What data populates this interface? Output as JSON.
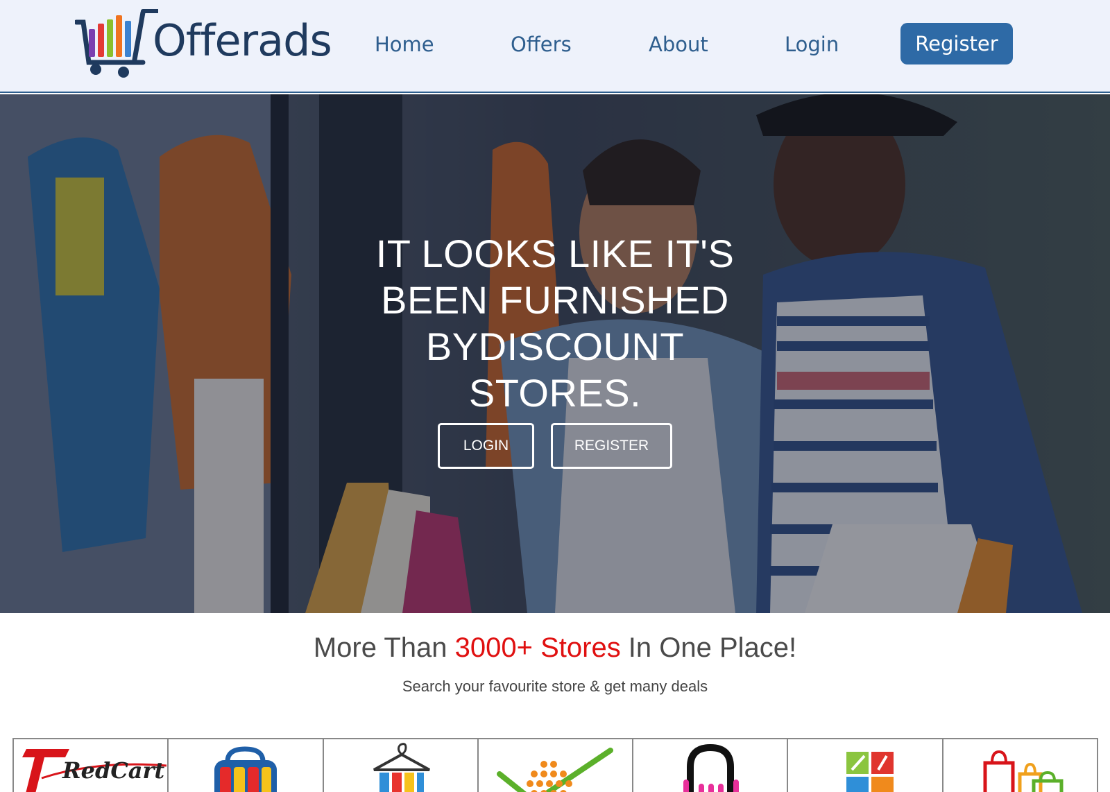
{
  "header": {
    "logo_text": "Offerads",
    "nav": {
      "home": "Home",
      "offers": "Offers",
      "about": "About",
      "login": "Login",
      "register": "Register"
    },
    "colors": {
      "accent": "#2e6aa6",
      "background": "#eef2fb"
    }
  },
  "hero": {
    "title_lines": [
      "IT LOOKS LIKE IT'S",
      "BEEN FURNISHED",
      "BYDISCOUNT",
      "STORES."
    ],
    "login_button": "LOGIN",
    "register_button": "REGISTER"
  },
  "stores": {
    "heading_prefix": "More Than ",
    "heading_highlight": "3000+ Stores",
    "heading_suffix": " In One Place!",
    "subheading": "Search your favourite store & get many deals",
    "highlight_color": "#e01010",
    "logos": [
      {
        "name": "redcart-logo",
        "text": "RedCart"
      },
      {
        "name": "shopping-bag-logo"
      },
      {
        "name": "hanger-logo"
      },
      {
        "name": "cart-check-logo"
      },
      {
        "name": "shopping-bag-outline-logo"
      },
      {
        "name": "grid-tiles-logo"
      },
      {
        "name": "bags-logo"
      }
    ]
  }
}
